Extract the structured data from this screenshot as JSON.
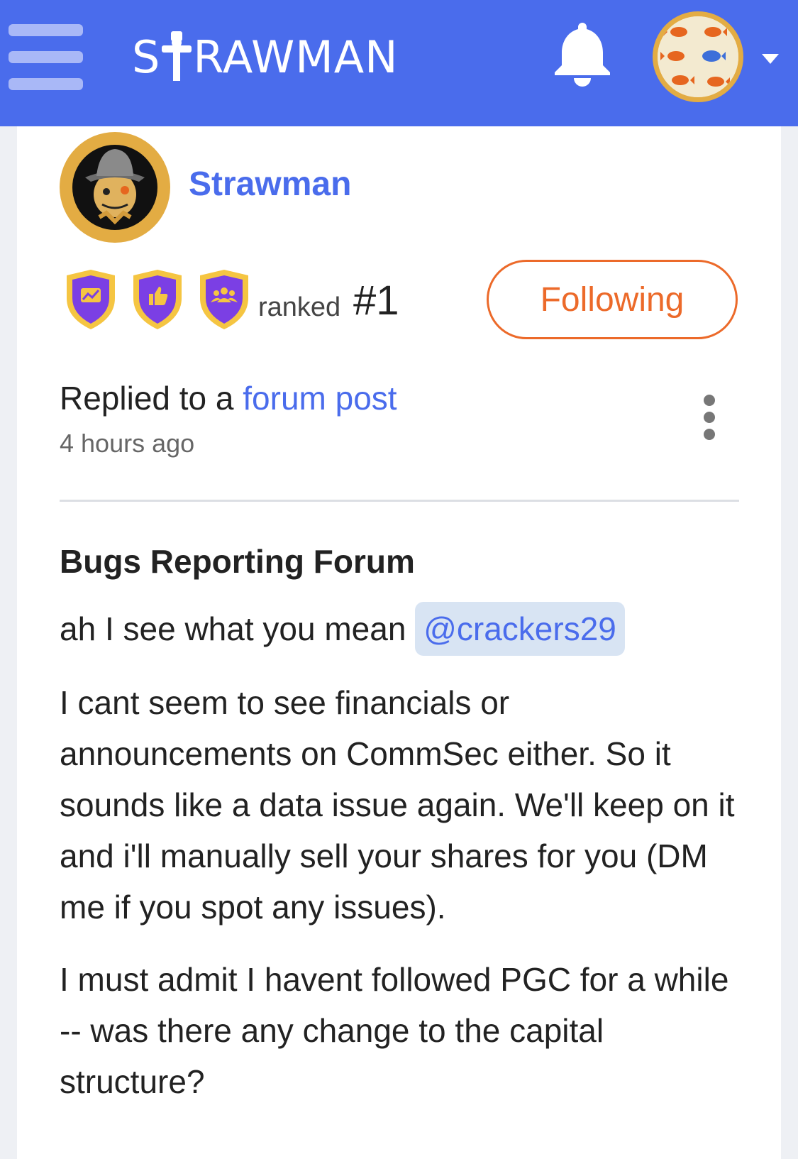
{
  "header": {
    "menu_icon": "hamburger-menu-icon",
    "logo_text": "STRAWMAN",
    "logo_prefix": "S",
    "logo_suffix": "RAWMAN",
    "notification_icon": "bell-icon",
    "account_menu_icon": "chevron-down-icon",
    "brand_color": "#4a6cec"
  },
  "profile": {
    "username": "Strawman",
    "avatar_icon": "scarecrow-avatar-icon",
    "badges": [
      "chart-badge-icon",
      "thumbs-up-badge-icon",
      "group-badge-icon"
    ],
    "rank_label": "ranked",
    "rank_value": "#1",
    "follow_label": "Following",
    "accent_color": "#ec6a2a"
  },
  "activity": {
    "prefix": "Replied to a",
    "link_text": "forum post",
    "time": "4 hours ago",
    "more_icon": "vertical-ellipsis-icon"
  },
  "post": {
    "forum": "Bugs Reporting Forum",
    "para1_text": "ah I see what you mean",
    "mention": "@crackers29",
    "para2": "I cant seem to see financials or announcements on CommSec either. So it sounds like a data issue again. We'll keep on it and i'll manually sell your shares for you (DM me if you spot any issues).",
    "para3": "I must admit I havent followed PGC for a while -- was there any change to the capital structure?"
  }
}
